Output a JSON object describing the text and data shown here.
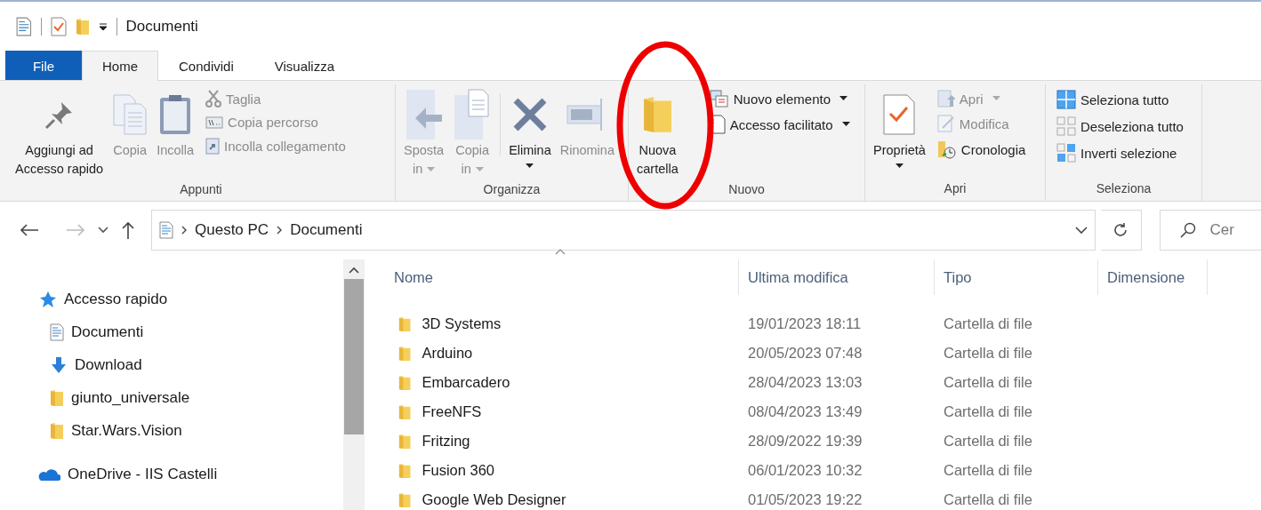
{
  "window": {
    "title": "Documenti"
  },
  "ribbon_tabs": [
    {
      "label": "File",
      "kind": "file",
      "selected": false
    },
    {
      "label": "Home",
      "kind": "tab",
      "selected": true
    },
    {
      "label": "Condividi",
      "kind": "tab",
      "selected": false
    },
    {
      "label": "Visualizza",
      "kind": "tab",
      "selected": false
    }
  ],
  "ribbon_groups": [
    {
      "label": "Appunti",
      "items": [
        {
          "kind": "large",
          "label": "Aggiungi ad\nAccesso rapido",
          "disabled": false,
          "dropdown": false
        },
        {
          "kind": "large",
          "label": "Copia",
          "disabled": true,
          "dropdown": false
        },
        {
          "kind": "large",
          "label": "Incolla",
          "disabled": true,
          "dropdown": false
        },
        {
          "kind": "stack",
          "items": [
            {
              "label": "Taglia",
              "disabled": true,
              "dropdown": false
            },
            {
              "label": "Copia percorso",
              "disabled": true,
              "dropdown": false
            },
            {
              "label": "Incolla collegamento",
              "disabled": true,
              "dropdown": false
            }
          ]
        }
      ]
    },
    {
      "label": "Organizza",
      "items": [
        {
          "kind": "large",
          "label": "Sposta\nin",
          "disabled": true,
          "dropdown": true
        },
        {
          "kind": "large",
          "label": "Copia\nin",
          "disabled": true,
          "dropdown": true
        },
        {
          "kind": "separator"
        },
        {
          "kind": "large",
          "label": "Elimina",
          "disabled": false,
          "dropdown": true
        },
        {
          "kind": "large",
          "label": "Rinomina",
          "disabled": true,
          "dropdown": false
        }
      ]
    },
    {
      "label": "Nuovo",
      "items": [
        {
          "kind": "large",
          "label": "Nuova\ncartella",
          "disabled": false,
          "dropdown": false
        },
        {
          "kind": "stack",
          "items": [
            {
              "label": "Nuovo elemento",
              "disabled": false,
              "dropdown": true
            },
            {
              "label": "Accesso facilitato",
              "disabled": false,
              "dropdown": true
            }
          ]
        }
      ]
    },
    {
      "label": "Apri",
      "items": [
        {
          "kind": "large",
          "label": "Proprietà",
          "disabled": false,
          "dropdown": true
        },
        {
          "kind": "stack",
          "items": [
            {
              "label": "Apri",
              "disabled": true,
              "dropdown": true
            },
            {
              "label": "Modifica",
              "disabled": true,
              "dropdown": false
            },
            {
              "label": "Cronologia",
              "disabled": false,
              "dropdown": false
            }
          ]
        }
      ]
    },
    {
      "label": "Seleziona",
      "items": [
        {
          "kind": "stack",
          "items": [
            {
              "label": "Seleziona tutto",
              "disabled": false,
              "dropdown": false
            },
            {
              "label": "Deseleziona tutto",
              "disabled": false,
              "dropdown": false
            },
            {
              "label": "Inverti selezione",
              "disabled": false,
              "dropdown": false
            }
          ]
        }
      ]
    }
  ],
  "address_bar": {
    "path": [
      "Questo PC",
      "Documenti"
    ]
  },
  "search": {
    "placeholder": "Cer"
  },
  "nav_pane": {
    "items": [
      {
        "label": "Accesso rapido",
        "children": [
          {
            "label": "Documenti"
          },
          {
            "label": "Download"
          },
          {
            "label": "giunto_universale"
          },
          {
            "label": "Star.Wars.Vision"
          }
        ]
      },
      {
        "label": "OneDrive - IIS Castelli"
      }
    ]
  },
  "table": {
    "columns": [
      {
        "label": "Nome",
        "sorted": true
      },
      {
        "label": "Ultima modifica",
        "sorted": false
      },
      {
        "label": "Tipo",
        "sorted": false
      },
      {
        "label": "Dimensione",
        "sorted": false
      }
    ],
    "rows": [
      {
        "name": "3D Systems",
        "modified": "19/01/2023 18:11",
        "type": "Cartella di file"
      },
      {
        "name": "Arduino",
        "modified": "20/05/2023 07:48",
        "type": "Cartella di file"
      },
      {
        "name": "Embarcadero",
        "modified": "28/04/2023 13:03",
        "type": "Cartella di file"
      },
      {
        "name": "FreeNFS",
        "modified": "08/04/2023 13:49",
        "type": "Cartella di file"
      },
      {
        "name": "Fritzing",
        "modified": "28/09/2022 19:39",
        "type": "Cartella di file"
      },
      {
        "name": "Fusion 360",
        "modified": "06/01/2023 10:32",
        "type": "Cartella di file"
      },
      {
        "name": "Google Web Designer",
        "modified": "01/05/2023 19:22",
        "type": "Cartella di file"
      }
    ]
  }
}
